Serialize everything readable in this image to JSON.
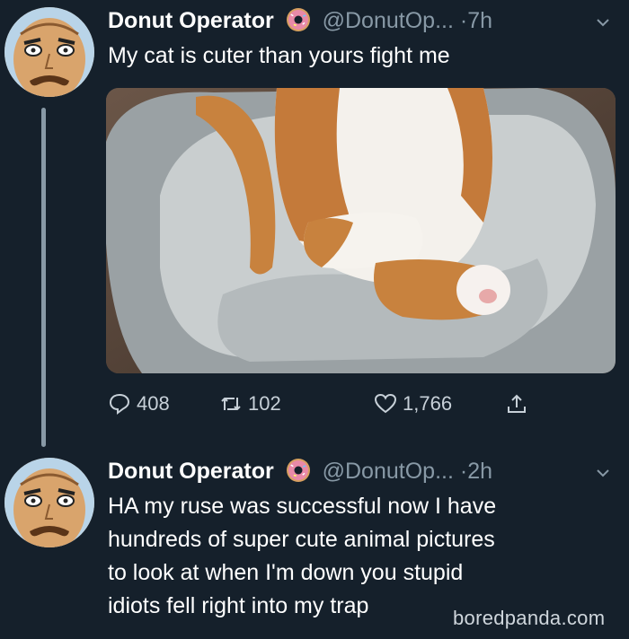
{
  "tweets": [
    {
      "name": "Donut Operator",
      "handle": "@DonutOp...",
      "dot": "·",
      "time": "7h",
      "text_lines": [
        "My cat is cuter than yours fight me"
      ],
      "actions": {
        "replies": "408",
        "retweets": "102",
        "likes": "1,766"
      }
    },
    {
      "name": "Donut Operator",
      "handle": "@DonutOp...",
      "dot": "·",
      "time": "2h",
      "text_lines": [
        "HA my ruse was successful now I have",
        "hundreds of super cute animal pictures",
        "to look at when I'm down you stupid",
        "idiots fell right into my trap"
      ]
    }
  ],
  "watermark": "boredpanda.com",
  "colors": {
    "background": "#15202b",
    "muted": "#8899a6",
    "text": "#ffffff"
  },
  "icons": [
    "avatar-face",
    "donut-emoji-icon",
    "chevron-down-icon",
    "reply-icon",
    "retweet-icon",
    "like-icon",
    "share-icon"
  ]
}
